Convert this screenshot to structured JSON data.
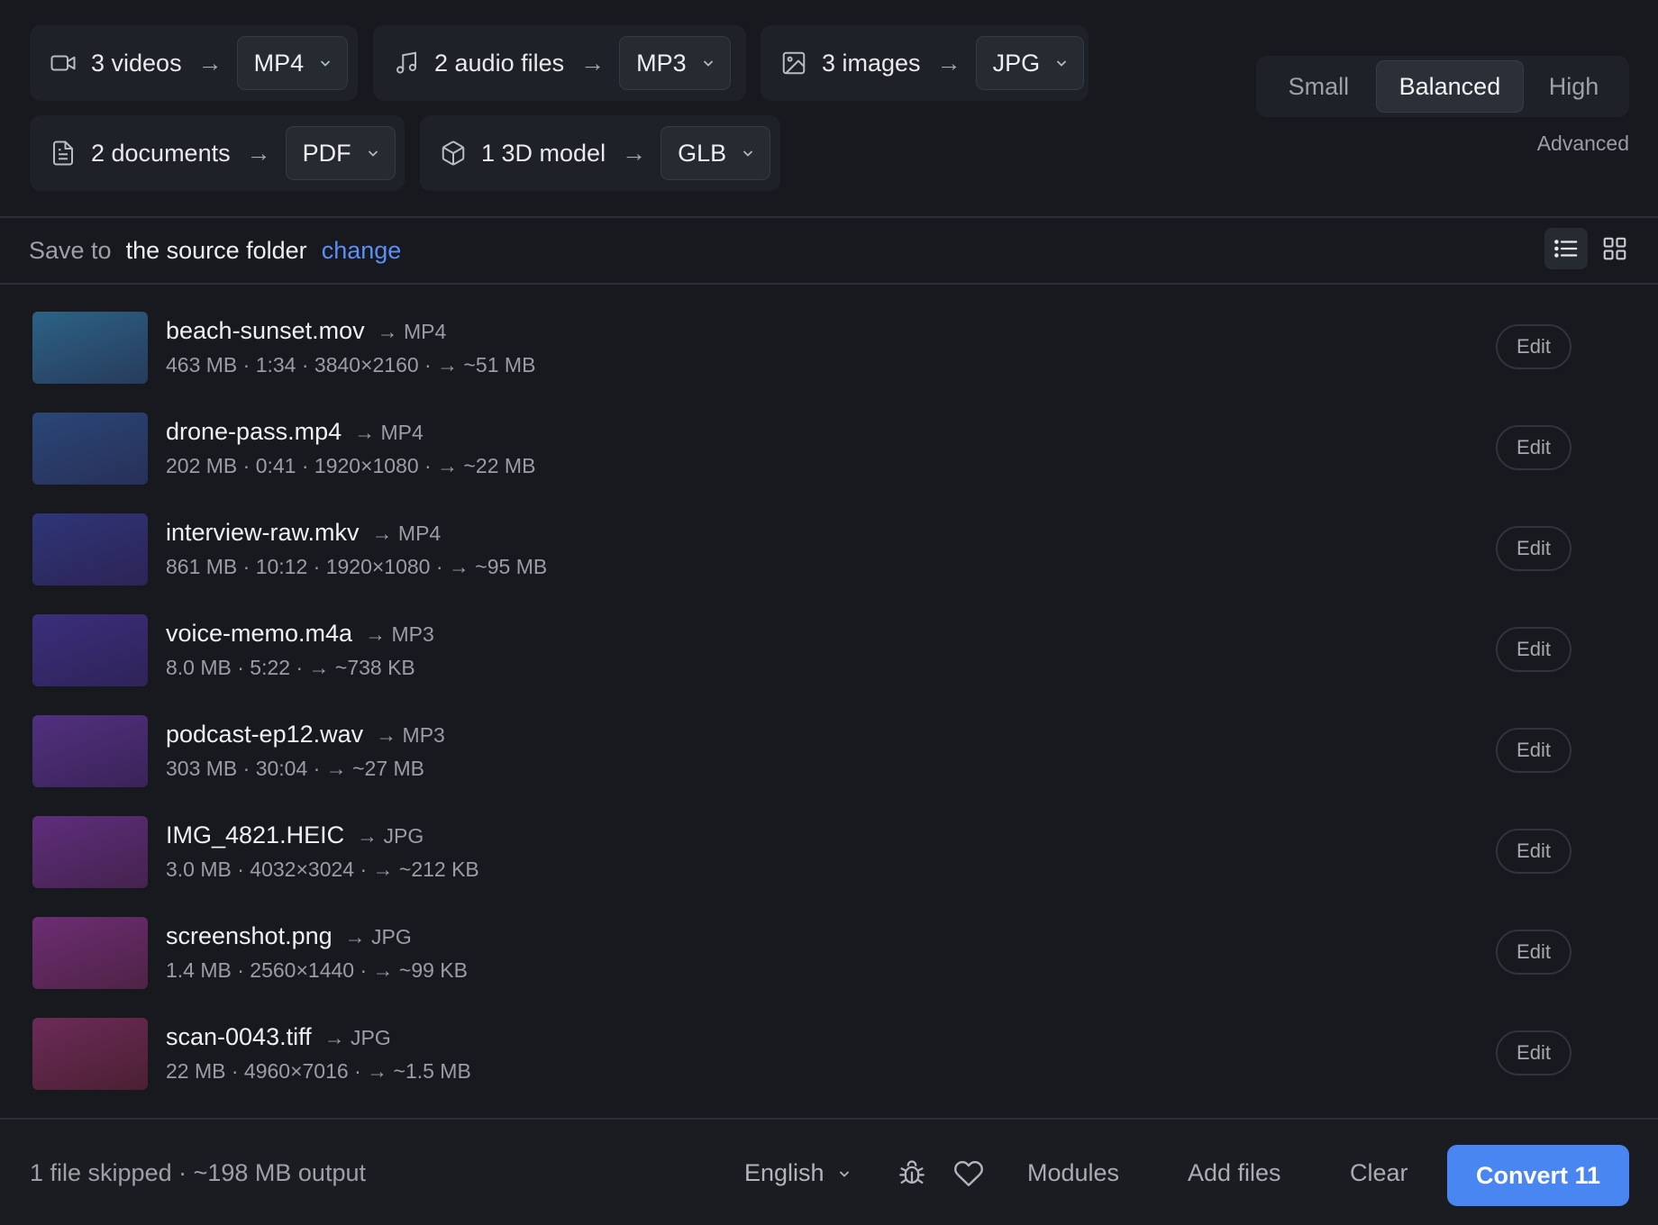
{
  "groups": {
    "videos": {
      "label": "3 videos",
      "arrow": "→",
      "format": "MP4",
      "icon": "video-camera-icon"
    },
    "audio": {
      "label": "2 audio files",
      "arrow": "→",
      "format": "MP3",
      "icon": "music-note-icon"
    },
    "images": {
      "label": "3 images",
      "arrow": "→",
      "format": "JPG",
      "icon": "image-icon"
    },
    "docs": {
      "label": "2 documents",
      "arrow": "→",
      "format": "PDF",
      "icon": "document-icon"
    },
    "model": {
      "label": "1 3D model",
      "arrow": "→",
      "format": "GLB",
      "icon": "cube-icon"
    }
  },
  "quality": {
    "options": [
      "Small",
      "Balanced",
      "High"
    ],
    "selected": "Balanced",
    "advanced_label": "Advanced"
  },
  "save": {
    "label": "Save to",
    "folder": "the source folder",
    "change_label": "change"
  },
  "view": {
    "selected": "list",
    "icons": [
      "list-view-icon",
      "grid-view-icon"
    ]
  },
  "files": [
    {
      "name": "beach-sunset.mov",
      "target": "→ MP4",
      "meta": "463 MB · 1:34 · 3840×2160 · → ~51 MB",
      "edit": "Edit"
    },
    {
      "name": "drone-pass.mp4",
      "target": "→ MP4",
      "meta": "202 MB · 0:41 · 1920×1080 · → ~22 MB",
      "edit": "Edit"
    },
    {
      "name": "interview-raw.mkv",
      "target": "→ MP4",
      "meta": "861 MB · 10:12 · 1920×1080 · → ~95 MB",
      "edit": "Edit"
    },
    {
      "name": "voice-memo.m4a",
      "target": "→ MP3",
      "meta": "8.0 MB · 5:22 · → ~738 KB",
      "edit": "Edit"
    },
    {
      "name": "podcast-ep12.wav",
      "target": "→ MP3",
      "meta": "303 MB · 30:04 · → ~27 MB",
      "edit": "Edit"
    },
    {
      "name": "IMG_4821.HEIC",
      "target": "→ JPG",
      "meta": "3.0 MB · 4032×3024 · → ~212 KB",
      "edit": "Edit"
    },
    {
      "name": "screenshot.png",
      "target": "→ JPG",
      "meta": "1.4 MB · 2560×1440 · → ~99 KB",
      "edit": "Edit"
    },
    {
      "name": "scan-0043.tiff",
      "target": "→ JPG",
      "meta": "22 MB · 4960×7016 · → ~1.5 MB",
      "edit": "Edit"
    }
  ],
  "thumb_colors": [
    [
      "#2c6285",
      "#273b5c"
    ],
    [
      "#2a4677",
      "#283058"
    ],
    [
      "#2e3578",
      "#2d2456"
    ],
    [
      "#3b2e7c",
      "#2f2358"
    ],
    [
      "#51307f",
      "#3a2358"
    ],
    [
      "#5e2d7c",
      "#45234e"
    ],
    [
      "#6c2d74",
      "#4f2345"
    ],
    [
      "#6c2b58",
      "#4b2032"
    ]
  ],
  "footer": {
    "status": "1 file skipped · ~198 MB output",
    "language": "English",
    "modules": "Modules",
    "add_files": "Add files",
    "clear": "Clear",
    "convert": "Convert 11"
  },
  "colors": {
    "background": "#17191e",
    "accent": "#4a86f2",
    "link": "#5b8ef7"
  }
}
